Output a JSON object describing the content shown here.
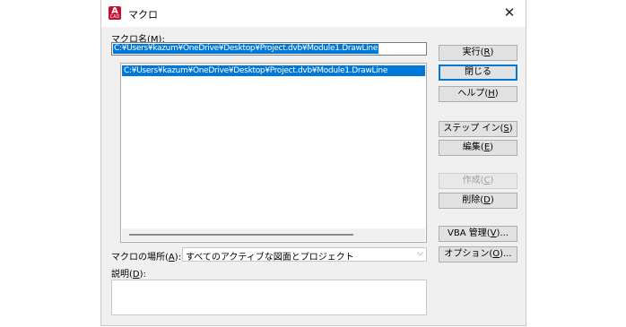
{
  "window": {
    "title": "マクロ",
    "app_icon_letter": "A",
    "app_icon_caption": "CAD"
  },
  "macro_name": {
    "label_prefix": "マクロ名(",
    "label_key": "M",
    "label_suffix": "):",
    "value": "C:¥Users¥kazum¥OneDrive¥Desktop¥Project.dvb¥Module1.DrawLine"
  },
  "macro_list": {
    "items": [
      "C:¥Users¥kazum¥OneDrive¥Desktop¥Project.dvb¥Module1.DrawLine"
    ]
  },
  "location": {
    "label_prefix": "マクロの場所(",
    "label_key": "A",
    "label_suffix": "):",
    "selected": "すべてのアクティブな図面とプロジェクト"
  },
  "description": {
    "label_prefix": "説明(",
    "label_key": "D",
    "label_suffix": "):",
    "value": ""
  },
  "buttons": {
    "run": {
      "prefix": "実行(",
      "key": "R",
      "suffix": ")"
    },
    "close": {
      "prefix": "閉じる",
      "key": "",
      "suffix": ""
    },
    "help": {
      "prefix": "ヘルプ(",
      "key": "H",
      "suffix": ")"
    },
    "step_in": {
      "prefix": "ステップ イン(",
      "key": "S",
      "suffix": ")"
    },
    "edit": {
      "prefix": "編集(",
      "key": "E",
      "suffix": ")"
    },
    "create": {
      "prefix": "作成(",
      "key": "C",
      "suffix": ")"
    },
    "delete": {
      "prefix": "削除(",
      "key": "D",
      "suffix": ")"
    },
    "vba": {
      "prefix": "VBA 管理(",
      "key": "V",
      "suffix": ")..."
    },
    "options": {
      "prefix": "オプション(",
      "key": "O",
      "suffix": ")..."
    }
  },
  "icons": {
    "close": "close-icon",
    "dropdown": "chevron-down-icon",
    "app": "autocad-app-icon"
  },
  "colors": {
    "selection": "#0078d7",
    "dialog_bg": "#f0f0f0",
    "app_icon": "#c8102e"
  }
}
